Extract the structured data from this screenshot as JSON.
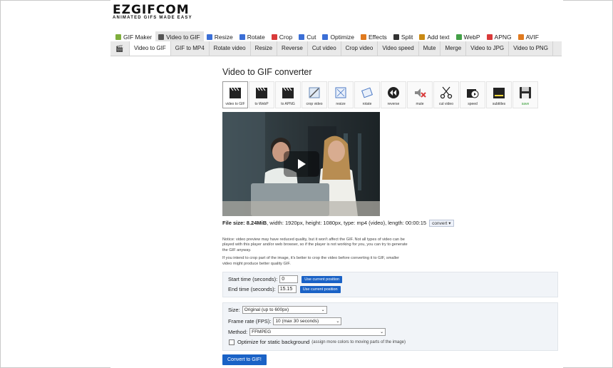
{
  "logo": {
    "main": "EZGIFCOM",
    "sub": "ANIMATED GIFS MADE EASY"
  },
  "topnav": [
    {
      "label": "GIF Maker",
      "icon": "gif-maker-icon",
      "color": "#7fae3c",
      "active": false
    },
    {
      "label": "Video to GIF",
      "icon": "film-icon",
      "color": "#555555",
      "active": true
    },
    {
      "label": "Resize",
      "icon": "resize-icon",
      "color": "#3b6fd6",
      "active": false
    },
    {
      "label": "Rotate",
      "icon": "rotate-icon",
      "color": "#3b6fd6",
      "active": false
    },
    {
      "label": "Crop",
      "icon": "crop-icon",
      "color": "#d93a3a",
      "active": false
    },
    {
      "label": "Cut",
      "icon": "cut-icon",
      "color": "#3b6fd6",
      "active": false
    },
    {
      "label": "Optimize",
      "icon": "optimize-icon",
      "color": "#3b6fd6",
      "active": false
    },
    {
      "label": "Effects",
      "icon": "effects-icon",
      "color": "#e07a1f",
      "active": false
    },
    {
      "label": "Split",
      "icon": "split-icon",
      "color": "#333333",
      "active": false
    },
    {
      "label": "Add text",
      "icon": "add-text-icon",
      "color": "#c98a14",
      "active": false
    },
    {
      "label": "WebP",
      "icon": "webp-icon",
      "color": "#43a047",
      "active": false
    },
    {
      "label": "APNG",
      "icon": "apng-icon",
      "color": "#d93a3a",
      "active": false
    },
    {
      "label": "AVIF",
      "icon": "avif-icon",
      "color": "#e07a1f",
      "active": false
    }
  ],
  "subnav": [
    "Video to GIF",
    "GIF to MP4",
    "Rotate video",
    "Resize",
    "Reverse",
    "Cut video",
    "Crop video",
    "Video speed",
    "Mute",
    "Merge",
    "Video to JPG",
    "Video to PNG"
  ],
  "subnav_active": "Video to GIF",
  "title": "Video to GIF converter",
  "tools": [
    {
      "label": "video to GIF",
      "icon": "clapperboard-icon",
      "active": true
    },
    {
      "label": "to WebP",
      "icon": "clapperboard-icon",
      "active": false
    },
    {
      "label": "to APNG",
      "icon": "clapperboard-icon",
      "active": false
    },
    {
      "label": "crop video",
      "icon": "crop-video-icon",
      "active": false
    },
    {
      "label": "resize",
      "icon": "resize-video-icon",
      "active": false
    },
    {
      "label": "rotate",
      "icon": "rotate-video-icon",
      "active": false
    },
    {
      "label": "reverse",
      "icon": "reverse-icon",
      "active": false
    },
    {
      "label": "mute",
      "icon": "mute-icon",
      "active": false
    },
    {
      "label": "cut video",
      "icon": "scissors-icon",
      "active": false
    },
    {
      "label": "speed",
      "icon": "speed-icon",
      "active": false
    },
    {
      "label": "subtitles",
      "icon": "subtitles-icon",
      "active": false
    },
    {
      "label": "save",
      "icon": "save-icon",
      "active": false
    }
  ],
  "video": {
    "state": "paused"
  },
  "fileinfo": {
    "label": "File size:",
    "size": "8.24MiB",
    "details": ", width: 1920px, height: 1080px, type: mp4 (video), length: 00:00:15",
    "convert_label": "convert"
  },
  "notice": {
    "p1": "Notice: video preview may have reduced quality, but it won't affect the GIF. Not all types of video can be played with this player and/or web browser, so if the player is not working for you, you can try to generate the GIF anyway.",
    "p2": "If you intend to crop part of the image, it's better to crop the video before converting it to GIF, smaller video might produce better quality GIF."
  },
  "times": {
    "start_label": "Start time (seconds):",
    "start_value": "0",
    "end_label": "End time (seconds):",
    "end_value": "15.15",
    "use_position": "Use current position"
  },
  "options": {
    "size_label": "Size:",
    "size_value": "Original (up to 600px)",
    "fps_label": "Frame rate (FPS):",
    "fps_value": "10 (max 30 seconds)",
    "method_label": "Method:",
    "method_value": "FFMPEG",
    "optimize_label": "Optimize for static background",
    "optimize_note": "(assign more colors to moving parts of the image)"
  },
  "submit": "Convert to GIF!"
}
